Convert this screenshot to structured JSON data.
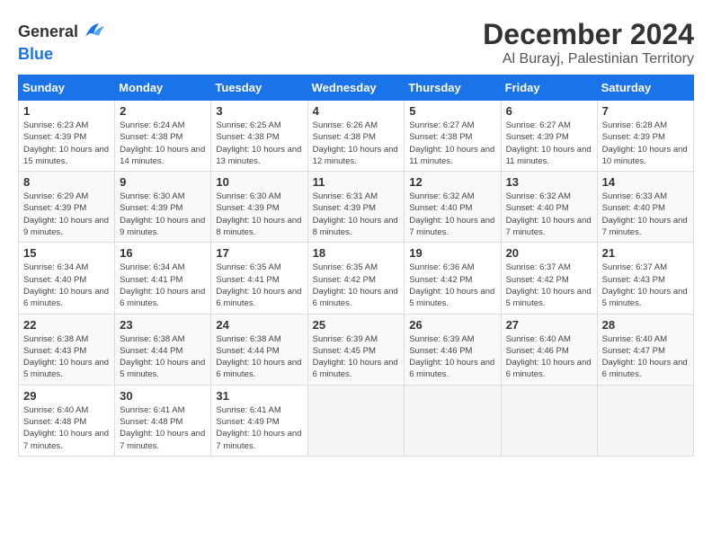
{
  "header": {
    "logo_general": "General",
    "logo_blue": "Blue",
    "month_title": "December 2024",
    "subtitle": "Al Burayj, Palestinian Territory"
  },
  "days_of_week": [
    "Sunday",
    "Monday",
    "Tuesday",
    "Wednesday",
    "Thursday",
    "Friday",
    "Saturday"
  ],
  "weeks": [
    [
      {
        "day": "1",
        "sunrise": "6:23 AM",
        "sunset": "4:39 PM",
        "daylight": "10 hours and 15 minutes."
      },
      {
        "day": "2",
        "sunrise": "6:24 AM",
        "sunset": "4:38 PM",
        "daylight": "10 hours and 14 minutes."
      },
      {
        "day": "3",
        "sunrise": "6:25 AM",
        "sunset": "4:38 PM",
        "daylight": "10 hours and 13 minutes."
      },
      {
        "day": "4",
        "sunrise": "6:26 AM",
        "sunset": "4:38 PM",
        "daylight": "10 hours and 12 minutes."
      },
      {
        "day": "5",
        "sunrise": "6:27 AM",
        "sunset": "4:38 PM",
        "daylight": "10 hours and 11 minutes."
      },
      {
        "day": "6",
        "sunrise": "6:27 AM",
        "sunset": "4:39 PM",
        "daylight": "10 hours and 11 minutes."
      },
      {
        "day": "7",
        "sunrise": "6:28 AM",
        "sunset": "4:39 PM",
        "daylight": "10 hours and 10 minutes."
      }
    ],
    [
      {
        "day": "8",
        "sunrise": "6:29 AM",
        "sunset": "4:39 PM",
        "daylight": "10 hours and 9 minutes."
      },
      {
        "day": "9",
        "sunrise": "6:30 AM",
        "sunset": "4:39 PM",
        "daylight": "10 hours and 9 minutes."
      },
      {
        "day": "10",
        "sunrise": "6:30 AM",
        "sunset": "4:39 PM",
        "daylight": "10 hours and 8 minutes."
      },
      {
        "day": "11",
        "sunrise": "6:31 AM",
        "sunset": "4:39 PM",
        "daylight": "10 hours and 8 minutes."
      },
      {
        "day": "12",
        "sunrise": "6:32 AM",
        "sunset": "4:40 PM",
        "daylight": "10 hours and 7 minutes."
      },
      {
        "day": "13",
        "sunrise": "6:32 AM",
        "sunset": "4:40 PM",
        "daylight": "10 hours and 7 minutes."
      },
      {
        "day": "14",
        "sunrise": "6:33 AM",
        "sunset": "4:40 PM",
        "daylight": "10 hours and 7 minutes."
      }
    ],
    [
      {
        "day": "15",
        "sunrise": "6:34 AM",
        "sunset": "4:40 PM",
        "daylight": "10 hours and 6 minutes."
      },
      {
        "day": "16",
        "sunrise": "6:34 AM",
        "sunset": "4:41 PM",
        "daylight": "10 hours and 6 minutes."
      },
      {
        "day": "17",
        "sunrise": "6:35 AM",
        "sunset": "4:41 PM",
        "daylight": "10 hours and 6 minutes."
      },
      {
        "day": "18",
        "sunrise": "6:35 AM",
        "sunset": "4:42 PM",
        "daylight": "10 hours and 6 minutes."
      },
      {
        "day": "19",
        "sunrise": "6:36 AM",
        "sunset": "4:42 PM",
        "daylight": "10 hours and 5 minutes."
      },
      {
        "day": "20",
        "sunrise": "6:37 AM",
        "sunset": "4:42 PM",
        "daylight": "10 hours and 5 minutes."
      },
      {
        "day": "21",
        "sunrise": "6:37 AM",
        "sunset": "4:43 PM",
        "daylight": "10 hours and 5 minutes."
      }
    ],
    [
      {
        "day": "22",
        "sunrise": "6:38 AM",
        "sunset": "4:43 PM",
        "daylight": "10 hours and 5 minutes."
      },
      {
        "day": "23",
        "sunrise": "6:38 AM",
        "sunset": "4:44 PM",
        "daylight": "10 hours and 5 minutes."
      },
      {
        "day": "24",
        "sunrise": "6:38 AM",
        "sunset": "4:44 PM",
        "daylight": "10 hours and 6 minutes."
      },
      {
        "day": "25",
        "sunrise": "6:39 AM",
        "sunset": "4:45 PM",
        "daylight": "10 hours and 6 minutes."
      },
      {
        "day": "26",
        "sunrise": "6:39 AM",
        "sunset": "4:46 PM",
        "daylight": "10 hours and 6 minutes."
      },
      {
        "day": "27",
        "sunrise": "6:40 AM",
        "sunset": "4:46 PM",
        "daylight": "10 hours and 6 minutes."
      },
      {
        "day": "28",
        "sunrise": "6:40 AM",
        "sunset": "4:47 PM",
        "daylight": "10 hours and 6 minutes."
      }
    ],
    [
      {
        "day": "29",
        "sunrise": "6:40 AM",
        "sunset": "4:48 PM",
        "daylight": "10 hours and 7 minutes."
      },
      {
        "day": "30",
        "sunrise": "6:41 AM",
        "sunset": "4:48 PM",
        "daylight": "10 hours and 7 minutes."
      },
      {
        "day": "31",
        "sunrise": "6:41 AM",
        "sunset": "4:49 PM",
        "daylight": "10 hours and 7 minutes."
      },
      null,
      null,
      null,
      null
    ]
  ]
}
